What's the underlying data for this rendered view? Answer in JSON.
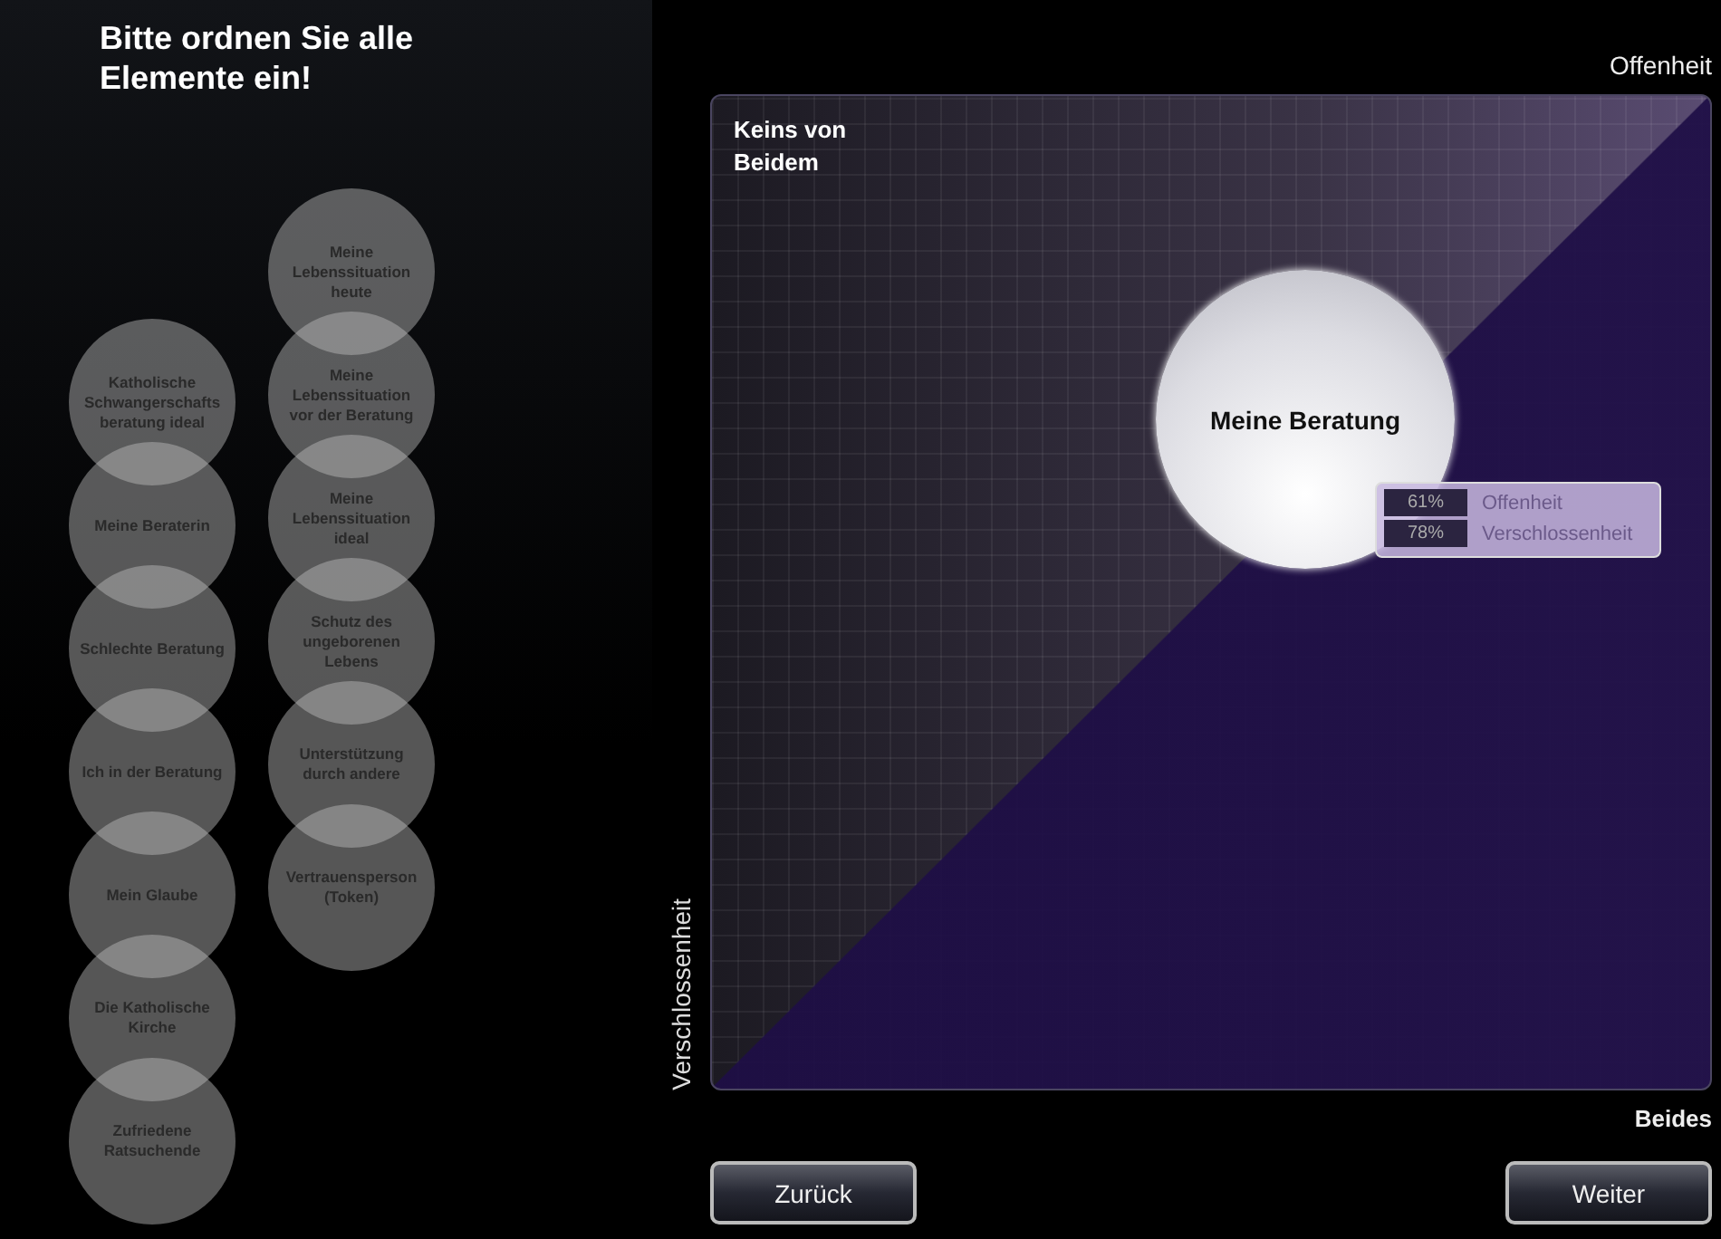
{
  "title": "Bitte ordnen Sie alle Elemente ein!",
  "element_columns": [
    [
      {
        "label": "Katholische Schwangerschaftsberatung ideal"
      },
      {
        "label": "Meine Beraterin"
      },
      {
        "label": "Schlechte Beratung"
      },
      {
        "label": "Ich in der Beratung"
      },
      {
        "label": "Mein Glaube"
      },
      {
        "label": "Die Katholische Kirche"
      },
      {
        "label": "Zufriedene Ratsuchende"
      }
    ],
    [
      {
        "label": "Meine Lebenssituation heute"
      },
      {
        "label": "Meine Lebenssituation vor der Beratung"
      },
      {
        "label": "Meine Lebenssituation ideal"
      },
      {
        "label": "Schutz des ungeborenen Lebens"
      },
      {
        "label": "Unterstützung durch andere"
      },
      {
        "label": "Vertrauensperson (Token)"
      }
    ]
  ],
  "axis_labels": {
    "top_right": "Offenheit",
    "top_left": "Keins von Beidem",
    "left": "Verschlossenheit",
    "bottom_right": "Beides"
  },
  "placed_element": {
    "label": "Meine Beratung",
    "readings": [
      {
        "value": "61%",
        "name": "Offenheit"
      },
      {
        "value": "78%",
        "name": "Verschlossenheit"
      }
    ]
  },
  "buttons": {
    "back": "Zurück",
    "next": "Weiter"
  }
}
